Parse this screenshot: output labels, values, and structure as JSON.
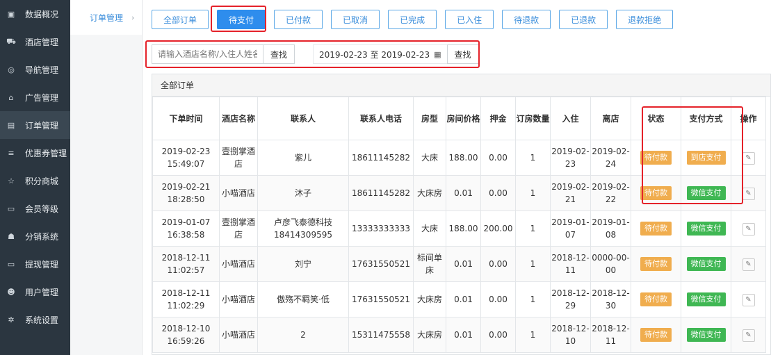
{
  "sidebar": {
    "items": [
      {
        "label": "数据概况",
        "icon": "desktop-icon",
        "glyph": "▣"
      },
      {
        "label": "酒店管理",
        "icon": "cart-icon",
        "glyph": "⛟"
      },
      {
        "label": "导航管理",
        "icon": "compass-icon",
        "glyph": "◎"
      },
      {
        "label": "广告管理",
        "icon": "gift-icon",
        "glyph": "⌂"
      },
      {
        "label": "订单管理",
        "icon": "list-icon",
        "glyph": "▤"
      },
      {
        "label": "优惠券管理",
        "icon": "menu-icon",
        "glyph": "≡"
      },
      {
        "label": "积分商城",
        "icon": "star-icon",
        "glyph": "☆"
      },
      {
        "label": "会员等级",
        "icon": "card-icon",
        "glyph": "▭"
      },
      {
        "label": "分销系统",
        "icon": "users-icon",
        "glyph": "☗"
      },
      {
        "label": "提现管理",
        "icon": "money-icon",
        "glyph": "▭"
      },
      {
        "label": "用户管理",
        "icon": "user-icon",
        "glyph": "☻"
      },
      {
        "label": "系统设置",
        "icon": "gear-icon",
        "glyph": "✲"
      }
    ],
    "active_index": 4
  },
  "subnav": {
    "label": "订单管理",
    "chevron": "›"
  },
  "tabs": [
    "全部订单",
    "待支付",
    "已付款",
    "已取消",
    "已完成",
    "已入住",
    "待退款",
    "已退款",
    "退款拒绝"
  ],
  "active_tab": 1,
  "search": {
    "placeholder": "请输入酒店名称/入住人姓名",
    "button": "查找",
    "date_range": "2019-02-23 至 2019-02-23",
    "date_button": "查找"
  },
  "panel_title": "全部订单",
  "table": {
    "headers": [
      "下单时间",
      "酒店名称",
      "联系人",
      "联系人电话",
      "房型",
      "房间价格",
      "押金",
      "订房数量",
      "入住",
      "离店",
      "状态",
      "支付方式",
      "操作"
    ],
    "rows": [
      {
        "time": "2019-02-23 15:49:07",
        "hotel": "壹捌掌酒店",
        "contact": "紫儿",
        "phone": "18611145282",
        "room": "大床",
        "price": "188.00",
        "deposit": "0.00",
        "qty": "1",
        "checkin": "2019-02-23",
        "checkout": "2019-02-24",
        "status": "待付款",
        "pay": "到店支付",
        "pay_color": "orange"
      },
      {
        "time": "2019-02-21 18:28:50",
        "hotel": "小喵酒店",
        "contact": "沐子",
        "phone": "18611145282",
        "room": "大床房",
        "price": "0.01",
        "deposit": "0.00",
        "qty": "1",
        "checkin": "2019-02-21",
        "checkout": "2019-02-22",
        "status": "待付款",
        "pay": "微信支付",
        "pay_color": "green"
      },
      {
        "time": "2019-01-07 16:38:58",
        "hotel": "壹捌掌酒店",
        "contact": "卢彦飞泰德科技 18414309595",
        "phone": "13333333333",
        "room": "大床",
        "price": "188.00",
        "deposit": "200.00",
        "qty": "1",
        "checkin": "2019-01-07",
        "checkout": "2019-01-08",
        "status": "待付款",
        "pay": "微信支付",
        "pay_color": "green"
      },
      {
        "time": "2018-12-11 11:02:57",
        "hotel": "小喵酒店",
        "contact": "刘宁",
        "phone": "17631550521",
        "room": "标间单床",
        "price": "0.01",
        "deposit": "0.00",
        "qty": "1",
        "checkin": "2018-12-11",
        "checkout": "0000-00-00",
        "status": "待付款",
        "pay": "微信支付",
        "pay_color": "green"
      },
      {
        "time": "2018-12-11 11:02:29",
        "hotel": "小喵酒店",
        "contact": "傲殇不羁笑·低",
        "phone": "17631550521",
        "room": "大床房",
        "price": "0.01",
        "deposit": "0.00",
        "qty": "1",
        "checkin": "2018-12-29",
        "checkout": "2018-12-30",
        "status": "待付款",
        "pay": "微信支付",
        "pay_color": "green"
      },
      {
        "time": "2018-12-10 16:59:26",
        "hotel": "小喵酒店",
        "contact": "2",
        "phone": "15311475558",
        "room": "大床房",
        "price": "0.01",
        "deposit": "0.00",
        "qty": "1",
        "checkin": "2018-12-10",
        "checkout": "2018-12-11",
        "status": "待付款",
        "pay": "微信支付",
        "pay_color": "green"
      }
    ]
  },
  "colors": {
    "primary": "#2e8ded",
    "sidebar": "#2b3640",
    "highlight": "#e5222a",
    "orange": "#f0ad4e",
    "green": "#3fb753"
  }
}
